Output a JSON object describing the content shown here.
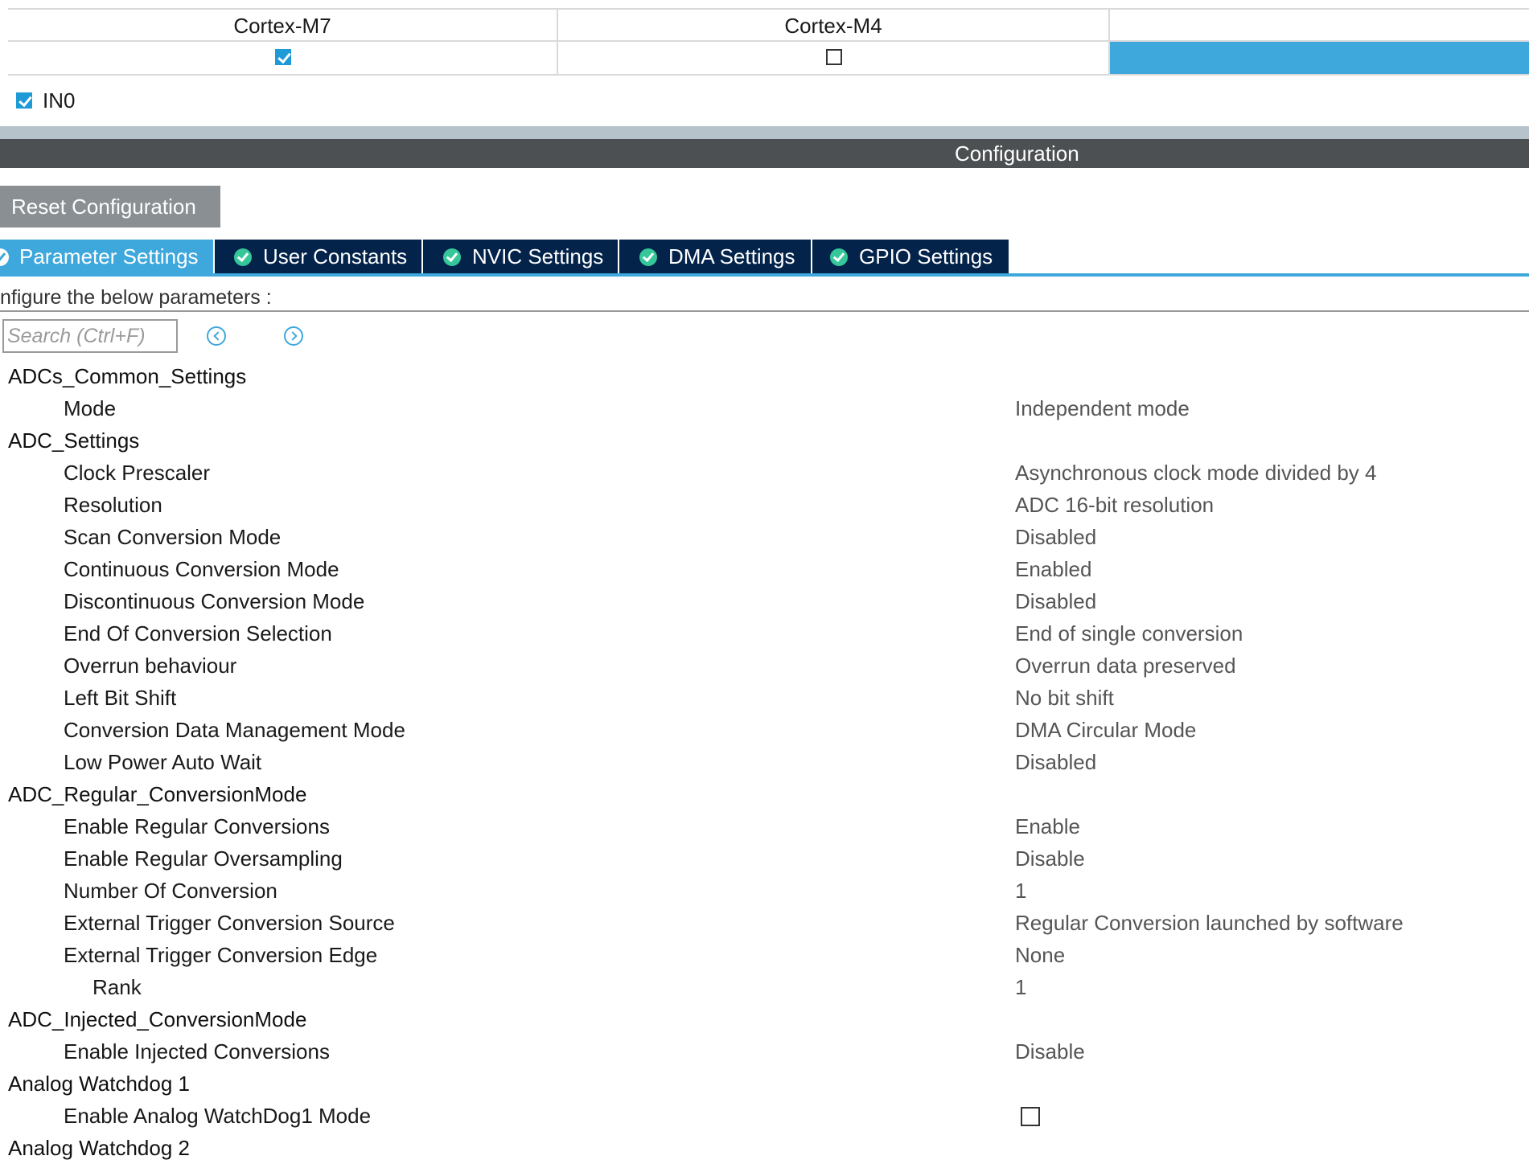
{
  "runtime": {
    "columns": [
      "Cortex-M7",
      "Cortex-M4"
    ],
    "m7_checked": true,
    "m4_checked": false
  },
  "in0": {
    "label": "IN0",
    "checked": true
  },
  "configuration": {
    "title": "Configuration"
  },
  "reset_button": "Reset Configuration",
  "tabs": [
    {
      "label": "Parameter Settings",
      "active": true
    },
    {
      "label": "User Constants",
      "active": false
    },
    {
      "label": "NVIC Settings",
      "active": false
    },
    {
      "label": "DMA Settings",
      "active": false
    },
    {
      "label": "GPIO Settings",
      "active": false
    }
  ],
  "instructions": "nfigure the below parameters :",
  "search": {
    "placeholder": "Search (Ctrl+F)"
  },
  "params": {
    "common_group": "ADCs_Common_Settings",
    "mode_label": "Mode",
    "mode_value": "Independent mode",
    "adc_group": "ADC_Settings",
    "clock_prescaler_label": "Clock Prescaler",
    "clock_prescaler_value": "Asynchronous clock mode divided by 4",
    "resolution_label": "Resolution",
    "resolution_value": "ADC 16-bit resolution",
    "scan_label": "Scan Conversion Mode",
    "scan_value": "Disabled",
    "continuous_label": "Continuous Conversion Mode",
    "continuous_value": "Enabled",
    "discontinuous_label": "Discontinuous Conversion Mode",
    "discontinuous_value": "Disabled",
    "eoc_label": "End Of Conversion Selection",
    "eoc_value": "End of single conversion",
    "overrun_label": "Overrun behaviour",
    "overrun_value": "Overrun data preserved",
    "left_shift_label": "Left Bit Shift",
    "left_shift_value": "No bit shift",
    "data_mgmt_label": "Conversion Data Management Mode",
    "data_mgmt_value": "DMA Circular Mode",
    "low_power_label": "Low Power Auto Wait",
    "low_power_value": "Disabled",
    "regular_group": "ADC_Regular_ConversionMode",
    "enable_regular_label": "Enable Regular Conversions",
    "enable_regular_value": "Enable",
    "regular_oversampling_label": "Enable Regular Oversampling",
    "regular_oversampling_value": "Disable",
    "num_conversion_label": "Number Of Conversion",
    "num_conversion_value": "1",
    "ext_trigger_source_label": "External Trigger Conversion Source",
    "ext_trigger_source_value": "Regular Conversion launched by software",
    "ext_trigger_edge_label": "External Trigger Conversion Edge",
    "ext_trigger_edge_value": "None",
    "rank_label": "Rank",
    "rank_value": "1",
    "injected_group": "ADC_Injected_ConversionMode",
    "enable_injected_label": "Enable Injected Conversions",
    "enable_injected_value": "Disable",
    "watchdog1_group": "Analog Watchdog 1",
    "watchdog1_enable_label": "Enable Analog WatchDog1 Mode",
    "watchdog1_enable_checked": false,
    "watchdog2_group": "Analog Watchdog 2"
  },
  "colors": {
    "accent": "#3ea7dc",
    "tab_dark": "#03234b",
    "config_bar": "#4d5052",
    "reset_button": "#8a8f93",
    "check_green": "#35c79a"
  }
}
